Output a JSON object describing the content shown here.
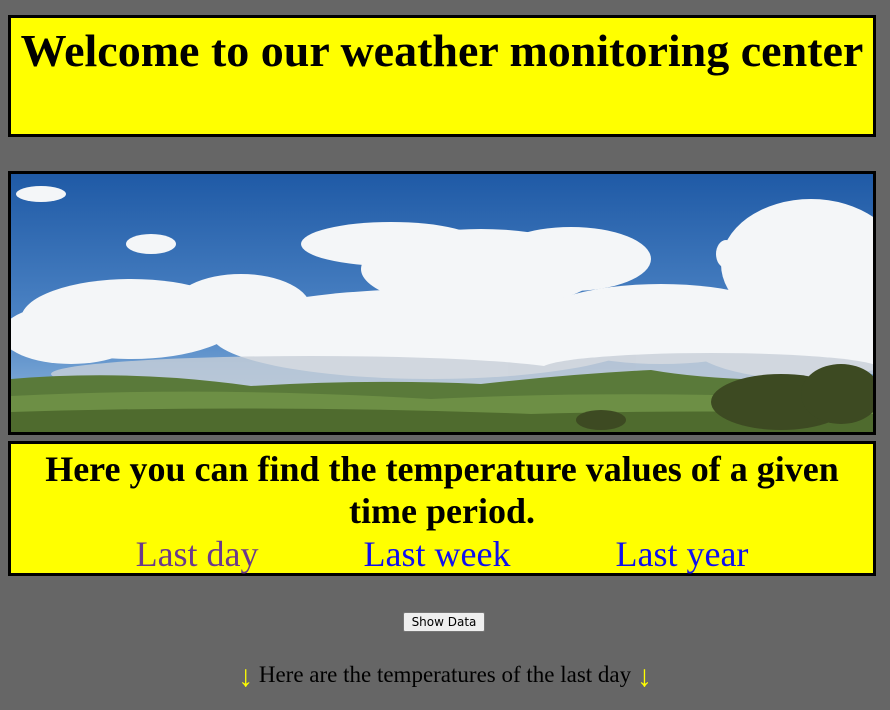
{
  "header": {
    "title": "Welcome to our weather monitoring center"
  },
  "banner": {
    "image_name": "sky-landscape-image"
  },
  "period_section": {
    "heading": "Here you can find the temperature values of a given time period.",
    "links": [
      "Last day",
      "Last week",
      "Last year"
    ]
  },
  "show_button": {
    "label": "Show Data"
  },
  "result": {
    "text": "Here are the temperatures of the last day",
    "arrow_left": "↓",
    "arrow_right": "↓"
  },
  "colors": {
    "background": "#666666",
    "box": "#ffff00",
    "border": "#000000",
    "visited_link": "#6b3a8c",
    "link": "#1010ee",
    "arrow": "#ffff00"
  }
}
